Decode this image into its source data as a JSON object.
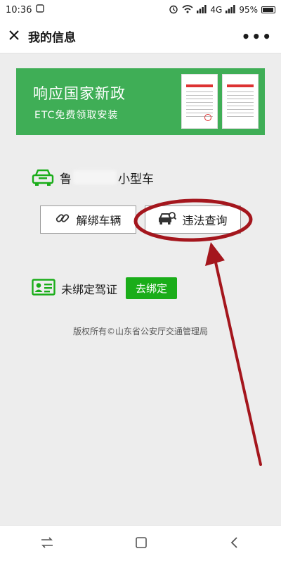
{
  "status_bar": {
    "time": "10:36",
    "network": "4G",
    "battery": "95%"
  },
  "header": {
    "title": "我的信息"
  },
  "banner": {
    "headline": "响应国家新政",
    "subline": "ETC免费领取安装",
    "bg_color": "#3fae56"
  },
  "vehicle": {
    "plate_prefix": "鲁",
    "plate_suffix": "小型车"
  },
  "actions": {
    "unbind_label": "解绑车辆",
    "violation_label": "违法查询"
  },
  "license": {
    "status": "未绑定驾证",
    "bind_label": "去绑定",
    "accent": "#1aad19"
  },
  "footer": {
    "copyright": "版权所有©山东省公安厅交通管理局"
  },
  "icons": [
    "close-icon",
    "more-icon",
    "car-icon",
    "link-icon",
    "car-search-icon",
    "id-card-icon",
    "back-icon",
    "home-icon",
    "recent-apps-icon"
  ]
}
